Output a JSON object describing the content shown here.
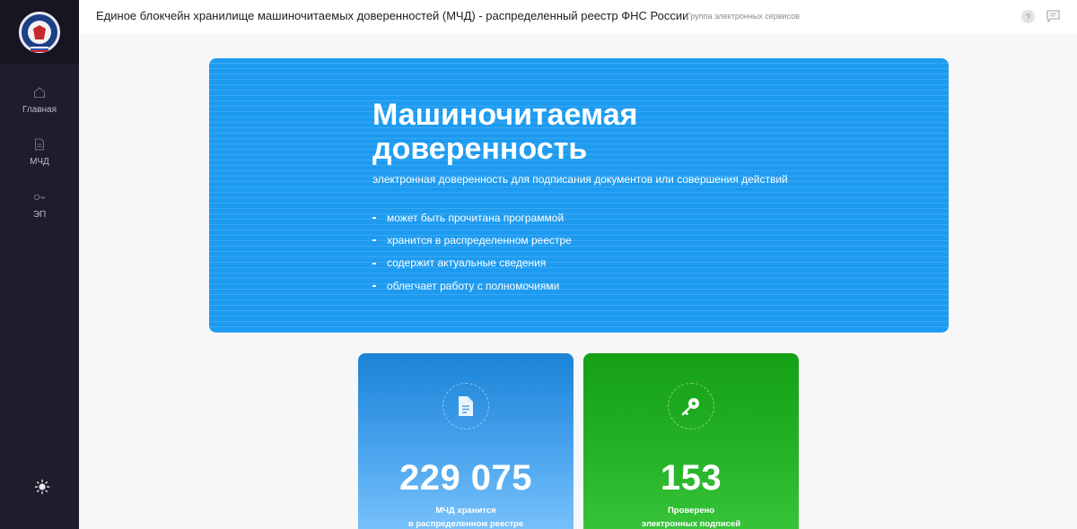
{
  "header": {
    "title": "Единое блокчейн хранилище машиночитаемых доверенностей (МЧД) - распределенный реестр ФНС России",
    "subtitle": "Группа электронных сервисов",
    "help_glyph": "?"
  },
  "sidebar": {
    "items": [
      {
        "label": "Главная",
        "icon": "home-icon"
      },
      {
        "label": "МЧД",
        "icon": "document-icon"
      },
      {
        "label": "ЭП",
        "icon": "key-icon"
      }
    ],
    "theme_icon": "sun-icon"
  },
  "banner": {
    "title": "Машиночитаемая доверенность",
    "subtitle": "электронная доверенность для подписания документов или совершения действий",
    "points": [
      "может быть прочитана программой",
      "хранится в распределенном реестре",
      "содержит актуальные сведения",
      "облегчает работу с полномочиями"
    ]
  },
  "stats": [
    {
      "number": "229 075",
      "caption_line1": "МЧД хранится",
      "caption_line2": "в распределенном реестре",
      "icon": "document-icon",
      "color": "#1a83d6"
    },
    {
      "number": "153",
      "caption_line1": "Проверено",
      "caption_line2": "электронных подписей",
      "icon": "key-icon",
      "color": "#15a015"
    }
  ]
}
